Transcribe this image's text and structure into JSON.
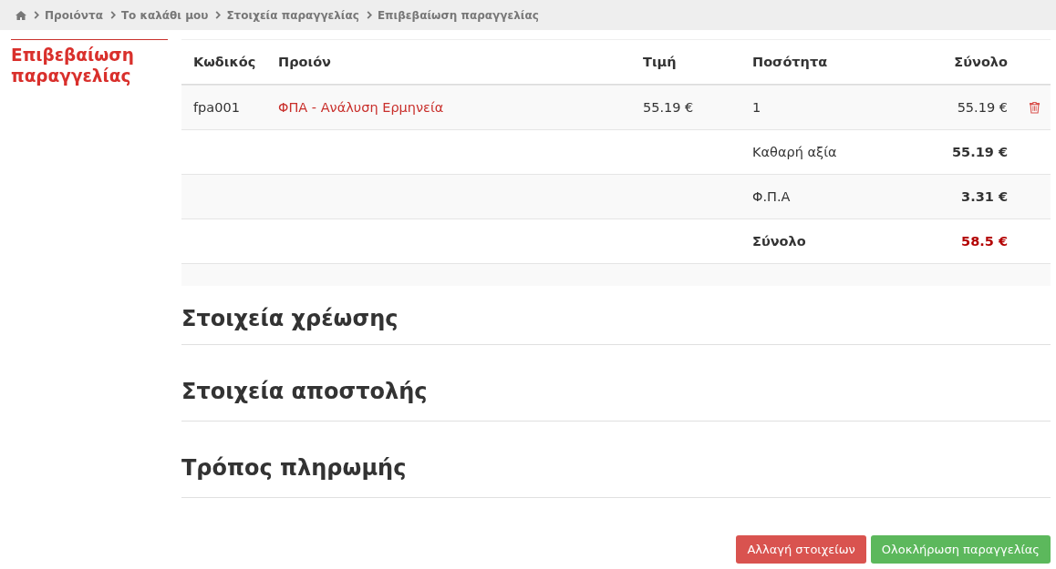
{
  "breadcrumb": [
    {
      "label": "Προιόντα"
    },
    {
      "label": "Το καλάθι μου"
    },
    {
      "label": "Στοιχεία παραγγελίας"
    },
    {
      "label": "Επιβεβαίωση παραγγελίας"
    }
  ],
  "sidebar": {
    "title": "Επιβεβαίωση παραγγελίας"
  },
  "table": {
    "columns": [
      "Κωδικός",
      "Προιόν",
      "Τιμή",
      "Ποσότητα",
      "Σύνολο"
    ],
    "rows": [
      {
        "code": "fpa001",
        "product": "ΦΠΑ - Ανάλυση Ερμηνεία",
        "price": "55.19 €",
        "quantity": "1",
        "total": "55.19 €"
      }
    ],
    "summary": [
      {
        "kind": "normal",
        "label": "Καθαρή αξία",
        "value": "55.19 €"
      },
      {
        "kind": "normal",
        "label": "Φ.Π.Α",
        "value": "3.31 €"
      },
      {
        "kind": "total",
        "label": "Σύνολο",
        "value": "58.5 €"
      }
    ]
  },
  "sections": [
    "Στοιχεία χρέωσης",
    "Στοιχεία αποστολής",
    "Τρόπος πληρωμής"
  ],
  "buttons": [
    {
      "kind": "danger",
      "label": "Αλλαγή στοιχείων"
    },
    {
      "kind": "success",
      "label": "Ολοκλήρωση παραγγελίας"
    }
  ]
}
